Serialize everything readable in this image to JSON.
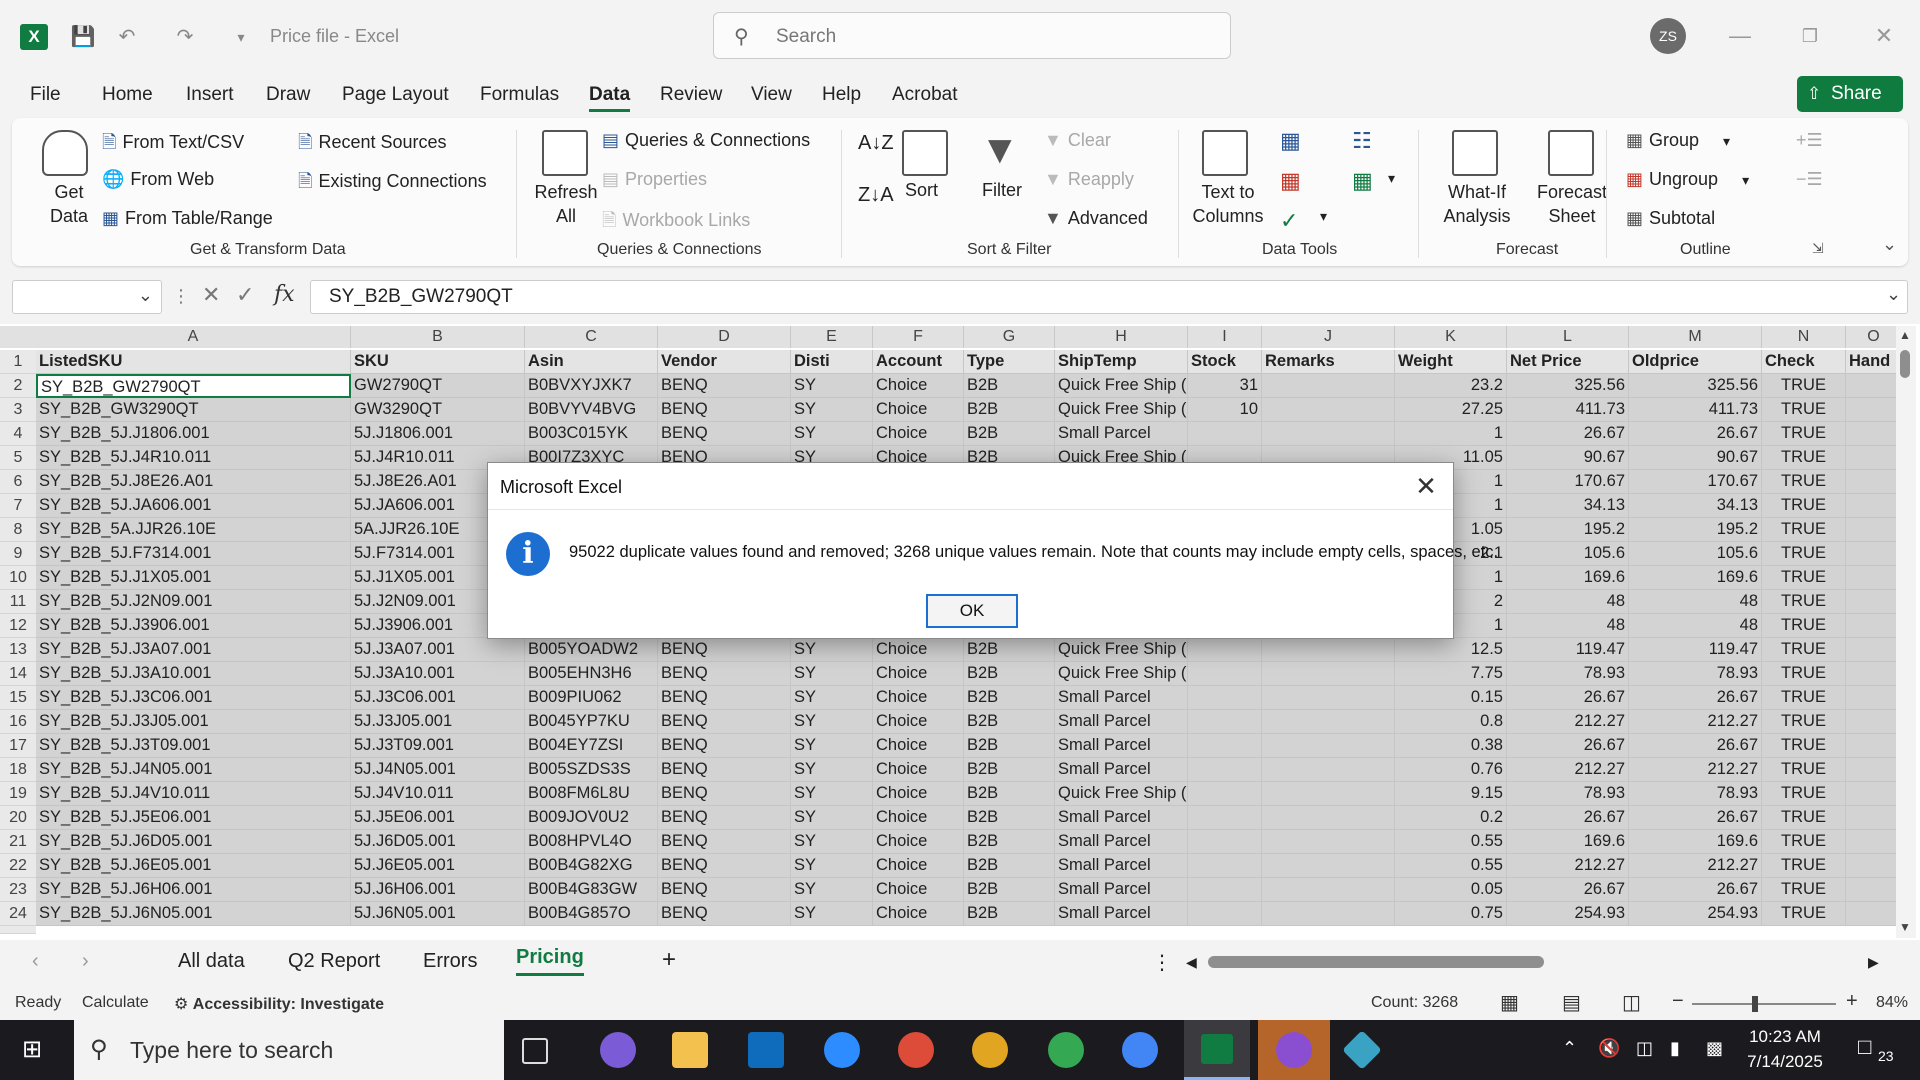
{
  "titlebar": {
    "app_label": "X",
    "title": "Price file  -  Excel",
    "search_placeholder": "Search",
    "user_initials": "ZS"
  },
  "menu": {
    "tabs": [
      "File",
      "Home",
      "Insert",
      "Draw",
      "Page Layout",
      "Formulas",
      "Data",
      "Review",
      "View",
      "Help",
      "Acrobat"
    ],
    "active": "Data",
    "share_label": "Share"
  },
  "ribbon": {
    "get_transform": {
      "group_label": "Get & Transform Data",
      "get_data": "Get Data",
      "from_text_csv": "From Text/CSV",
      "from_web": "From Web",
      "from_table_range": "From Table/Range",
      "recent_sources": "Recent Sources",
      "existing_connections": "Existing Connections"
    },
    "queries": {
      "group_label": "Queries & Connections",
      "refresh_all": "Refresh All",
      "queries_connections": "Queries & Connections",
      "properties": "Properties",
      "workbook_links": "Workbook Links"
    },
    "sort_filter": {
      "group_label": "Sort & Filter",
      "sort": "Sort",
      "filter": "Filter",
      "clear": "Clear",
      "reapply": "Reapply",
      "advanced": "Advanced"
    },
    "data_tools": {
      "group_label": "Data Tools",
      "text_to_columns": "Text to Columns"
    },
    "forecast": {
      "group_label": "Forecast",
      "what_if": "What-If Analysis",
      "forecast_sheet": "Forecast Sheet"
    },
    "outline": {
      "group_label": "Outline",
      "group": "Group",
      "ungroup": "Ungroup",
      "subtotal": "Subtotal"
    }
  },
  "formula_bar": {
    "name_box": "",
    "formula": "SY_B2B_GW2790QT"
  },
  "grid": {
    "columns": [
      "A",
      "B",
      "C",
      "D",
      "E",
      "F",
      "G",
      "H",
      "I",
      "J",
      "K",
      "L",
      "M",
      "N",
      "O"
    ],
    "headers": [
      "ListedSKU",
      "SKU",
      "Asin",
      "Vendor",
      "Disti",
      "Account",
      "Type",
      "ShipTemp",
      "Stock",
      "Remarks",
      "Weight",
      "Net Price",
      "Oldprice",
      "Check",
      "Hand"
    ],
    "rows": [
      {
        "n": "2",
        "v": [
          "SY_B2B_GW2790QT",
          "GW2790QT",
          "B0BVXYJXK7",
          "BENQ",
          "SY",
          "Choice",
          "B2B",
          "Quick Free Ship (",
          "31",
          "",
          "23.2",
          "325.56",
          "325.56",
          "TRUE",
          ""
        ]
      },
      {
        "n": "3",
        "v": [
          "SY_B2B_GW3290QT",
          "GW3290QT",
          "B0BVYV4BVG",
          "BENQ",
          "SY",
          "Choice",
          "B2B",
          "Quick Free Ship (",
          "10",
          "",
          "27.25",
          "411.73",
          "411.73",
          "TRUE",
          ""
        ]
      },
      {
        "n": "4",
        "v": [
          "SY_B2B_5J.J1806.001",
          "5J.J1806.001",
          "B003C015YK",
          "BENQ",
          "SY",
          "Choice",
          "B2B",
          "Small Parcel",
          "",
          "",
          "1",
          "26.67",
          "26.67",
          "TRUE",
          ""
        ]
      },
      {
        "n": "5",
        "v": [
          "SY_B2B_5J.J4R10.011",
          "5J.J4R10.011",
          "B00I7Z3XYC",
          "BENQ",
          "SY",
          "Choice",
          "B2B",
          "Quick Free Ship (",
          "",
          "",
          "11.05",
          "90.67",
          "90.67",
          "TRUE",
          ""
        ]
      },
      {
        "n": "6",
        "v": [
          "SY_B2B_5J.J8E26.A01",
          "5J.J8E26.A01",
          "",
          "",
          "",
          "",
          "",
          "",
          "",
          "",
          "1",
          "170.67",
          "170.67",
          "TRUE",
          ""
        ]
      },
      {
        "n": "7",
        "v": [
          "SY_B2B_5J.JA606.001",
          "5J.JA606.001",
          "",
          "",
          "",
          "",
          "",
          "",
          "",
          "",
          "1",
          "34.13",
          "34.13",
          "TRUE",
          ""
        ]
      },
      {
        "n": "8",
        "v": [
          "SY_B2B_5A.JJR26.10E",
          "5A.JJR26.10E",
          "",
          "",
          "",
          "",
          "",
          "",
          "",
          "",
          "1.05",
          "195.2",
          "195.2",
          "TRUE",
          ""
        ]
      },
      {
        "n": "9",
        "v": [
          "SY_B2B_5J.F7314.001",
          "5J.F7314.001",
          "",
          "",
          "",
          "",
          "",
          "",
          "",
          "",
          "2.1",
          "105.6",
          "105.6",
          "TRUE",
          ""
        ]
      },
      {
        "n": "10",
        "v": [
          "SY_B2B_5J.J1X05.001",
          "5J.J1X05.001",
          "",
          "",
          "",
          "",
          "",
          "",
          "",
          "",
          "1",
          "169.6",
          "169.6",
          "TRUE",
          ""
        ]
      },
      {
        "n": "11",
        "v": [
          "SY_B2B_5J.J2N09.001",
          "5J.J2N09.001",
          "",
          "",
          "",
          "",
          "",
          "",
          "",
          "",
          "2",
          "48",
          "48",
          "TRUE",
          ""
        ]
      },
      {
        "n": "12",
        "v": [
          "SY_B2B_5J.J3906.001",
          "5J.J3906.001",
          "",
          "",
          "",
          "",
          "",
          "",
          "",
          "",
          "1",
          "48",
          "48",
          "TRUE",
          ""
        ]
      },
      {
        "n": "13",
        "v": [
          "SY_B2B_5J.J3A07.001",
          "5J.J3A07.001",
          "B005YOADW2",
          "BENQ",
          "SY",
          "Choice",
          "B2B",
          "Quick Free Ship (",
          "",
          "",
          "12.5",
          "119.47",
          "119.47",
          "TRUE",
          ""
        ]
      },
      {
        "n": "14",
        "v": [
          "SY_B2B_5J.J3A10.001",
          "5J.J3A10.001",
          "B005EHN3H6",
          "BENQ",
          "SY",
          "Choice",
          "B2B",
          "Quick Free Ship (",
          "",
          "",
          "7.75",
          "78.93",
          "78.93",
          "TRUE",
          ""
        ]
      },
      {
        "n": "15",
        "v": [
          "SY_B2B_5J.J3C06.001",
          "5J.J3C06.001",
          "B009PIU062",
          "BENQ",
          "SY",
          "Choice",
          "B2B",
          "Small Parcel",
          "",
          "",
          "0.15",
          "26.67",
          "26.67",
          "TRUE",
          ""
        ]
      },
      {
        "n": "16",
        "v": [
          "SY_B2B_5J.J3J05.001",
          "5J.J3J05.001",
          "B0045YP7KU",
          "BENQ",
          "SY",
          "Choice",
          "B2B",
          "Small Parcel",
          "",
          "",
          "0.8",
          "212.27",
          "212.27",
          "TRUE",
          ""
        ]
      },
      {
        "n": "17",
        "v": [
          "SY_B2B_5J.J3T09.001",
          "5J.J3T09.001",
          "B004EY7ZSI",
          "BENQ",
          "SY",
          "Choice",
          "B2B",
          "Small Parcel",
          "",
          "",
          "0.38",
          "26.67",
          "26.67",
          "TRUE",
          ""
        ]
      },
      {
        "n": "18",
        "v": [
          "SY_B2B_5J.J4N05.001",
          "5J.J4N05.001",
          "B005SZDS3S",
          "BENQ",
          "SY",
          "Choice",
          "B2B",
          "Small Parcel",
          "",
          "",
          "0.76",
          "212.27",
          "212.27",
          "TRUE",
          ""
        ]
      },
      {
        "n": "19",
        "v": [
          "SY_B2B_5J.J4V10.011",
          "5J.J4V10.011",
          "B008FM6L8U",
          "BENQ",
          "SY",
          "Choice",
          "B2B",
          "Quick Free Ship (",
          "",
          "",
          "9.15",
          "78.93",
          "78.93",
          "TRUE",
          ""
        ]
      },
      {
        "n": "20",
        "v": [
          "SY_B2B_5J.J5E06.001",
          "5J.J5E06.001",
          "B009JOV0U2",
          "BENQ",
          "SY",
          "Choice",
          "B2B",
          "Small Parcel",
          "",
          "",
          "0.2",
          "26.67",
          "26.67",
          "TRUE",
          ""
        ]
      },
      {
        "n": "21",
        "v": [
          "SY_B2B_5J.J6D05.001",
          "5J.J6D05.001",
          "B008HPVL4O",
          "BENQ",
          "SY",
          "Choice",
          "B2B",
          "Small Parcel",
          "",
          "",
          "0.55",
          "169.6",
          "169.6",
          "TRUE",
          ""
        ]
      },
      {
        "n": "22",
        "v": [
          "SY_B2B_5J.J6E05.001",
          "5J.J6E05.001",
          "B00B4G82XG",
          "BENQ",
          "SY",
          "Choice",
          "B2B",
          "Small Parcel",
          "",
          "",
          "0.55",
          "212.27",
          "212.27",
          "TRUE",
          ""
        ]
      },
      {
        "n": "23",
        "v": [
          "SY_B2B_5J.J6H06.001",
          "5J.J6H06.001",
          "B00B4G83GW",
          "BENQ",
          "SY",
          "Choice",
          "B2B",
          "Small Parcel",
          "",
          "",
          "0.05",
          "26.67",
          "26.67",
          "TRUE",
          ""
        ]
      },
      {
        "n": "24",
        "v": [
          "SY_B2B_5J.J6N05.001",
          "5J.J6N05.001",
          "B00B4G857O",
          "BENQ",
          "SY",
          "Choice",
          "B2B",
          "Small Parcel",
          "",
          "",
          "0.75",
          "254.93",
          "254.93",
          "TRUE",
          ""
        ]
      }
    ]
  },
  "sheet_tabs": {
    "tabs": [
      "All data",
      "Q2 Report",
      "Errors",
      "Pricing"
    ],
    "active": "Pricing"
  },
  "status": {
    "ready": "Ready",
    "calculate": "Calculate",
    "accessibility": "Accessibility: Investigate",
    "count": "Count: 3268",
    "zoom": "84%"
  },
  "taskbar": {
    "search_placeholder": "Type here to search",
    "time": "10:23 AM",
    "date": "7/14/2025",
    "notifications": "23"
  },
  "dialog": {
    "title": "Microsoft Excel",
    "message": "95022 duplicate values found and removed; 3268 unique values remain. Note that counts may include empty cells, spaces, etc.",
    "ok_label": "OK"
  },
  "colors": {
    "excel_green": "#107c41",
    "accent_blue": "#1c6ed1",
    "selection_gray": "#d3d3d3"
  }
}
